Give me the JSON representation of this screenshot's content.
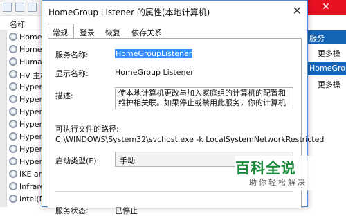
{
  "background": {
    "column_header": "名称",
    "services": [
      "HomeG",
      "HomeG",
      "Human",
      "HV 主机",
      "Hyper-",
      "Hyper-",
      "Hyper-",
      "Hyper-",
      "Hyper-",
      "Hyper-",
      "Hyper-",
      "IKE and",
      "Infrare",
      "Intel(R)"
    ],
    "actions_pane": {
      "header": "服务",
      "more_1": "更多操",
      "selected": "HomeGrou",
      "more_2": "更多操"
    }
  },
  "dialog": {
    "title": "HomeGroup Listener 的属性(本地计算机)",
    "close_glyph": "✕",
    "tabs": [
      "常规",
      "登录",
      "恢复",
      "依存关系"
    ],
    "fields": {
      "service_name_label": "服务名称:",
      "service_name_value": "HomeGroupListener",
      "display_name_label": "显示名称:",
      "display_name_value": "HomeGroup Listener",
      "description_label": "描述:",
      "description_value": "使本地计算机更改与加入家庭组的计算机的配置和维护相关联。如果停止或禁用此服务，你的计算机将无法在",
      "exe_path_label": "可执行文件的路径:",
      "exe_path_value": "C:\\WINDOWS\\System32\\svchost.exe -k LocalSystemNetworkRestricted",
      "startup_type_label": "启动类型(E):",
      "startup_type_value": "手动",
      "status_label": "服务状态:",
      "status_value": "已停止"
    }
  },
  "watermark": {
    "main": "百科全说",
    "sub": "助你轻松解决"
  }
}
